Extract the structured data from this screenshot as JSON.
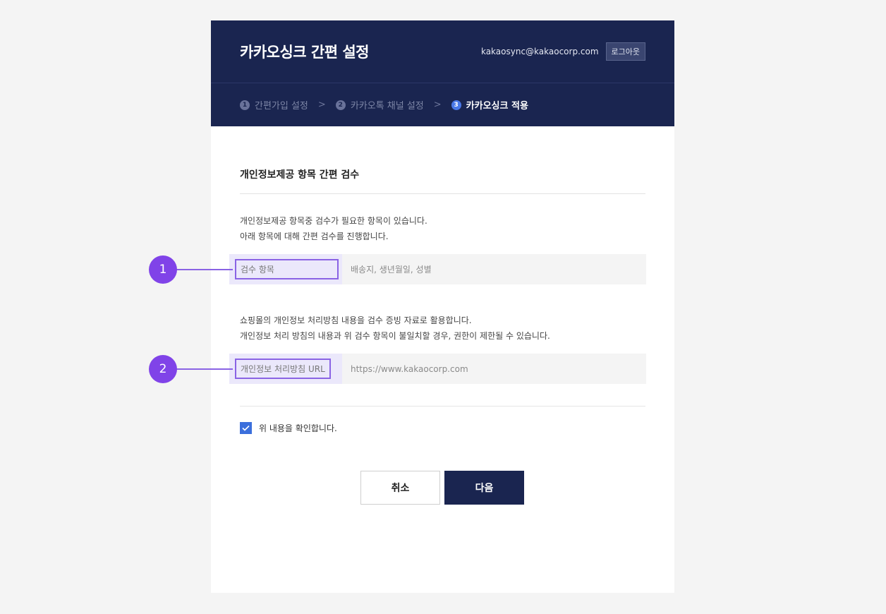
{
  "header": {
    "title": "카카오싱크 간편 설정",
    "user_email": "kakaosync@kakaocorp.com",
    "logout_label": "로그아웃"
  },
  "steps": [
    {
      "number": "1",
      "label": "간편가입 설정"
    },
    {
      "number": "2",
      "label": "카카오톡 채널 설정"
    },
    {
      "number": "3",
      "label": "카카오싱크 적용"
    }
  ],
  "section": {
    "title": "개인정보제공 항목 간편 검수",
    "desc1_line1": "개인정보제공 항목중 검수가 필요한 항목이 있습니다.",
    "desc1_line2": "아래 항목에 대해 간편 검수를 진행합니다.",
    "field1_label": "검수 항목",
    "field1_value": "배송지, 생년월일, 성별",
    "desc2_line1": "쇼핑몰의 개인정보 처리방침 내용을 검수 증빙 자료로 활용합니다.",
    "desc2_line2": "개인정보 처리 방침의 내용과 위 검수 항목이 불일치할 경우, 권한이 제한될 수 있습니다.",
    "field2_label": "개인정보 처리방침 URL",
    "field2_placeholder": "https://www.kakaocorp.com",
    "confirm_label": "위 내용을 확인합니다."
  },
  "buttons": {
    "cancel": "취소",
    "next": "다음"
  },
  "callouts": [
    "1",
    "2"
  ],
  "colors": {
    "header_bg": "#1a2550",
    "accent_purple": "#8043e8",
    "checkbox_blue": "#3b6fdc"
  }
}
